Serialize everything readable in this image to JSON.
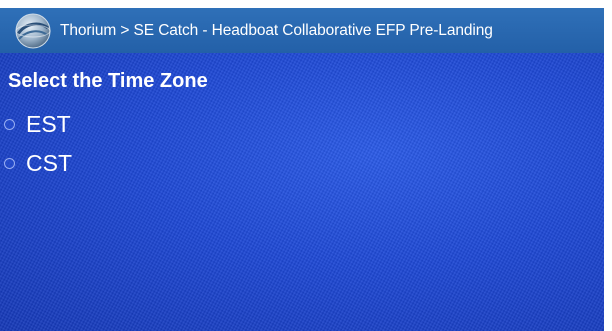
{
  "app_bar": {
    "title": "Thorium > SE Catch - Headboat Collaborative EFP Pre-Landing",
    "icon": "globe-app-icon"
  },
  "question": {
    "title": "Select the Time Zone"
  },
  "time_zone_options": [
    {
      "label": "EST",
      "selected": false
    },
    {
      "label": "CST",
      "selected": false
    }
  ],
  "colors": {
    "app_bar": "#2a67b0",
    "background": "#1f4bd8",
    "text": "#ffffff"
  }
}
